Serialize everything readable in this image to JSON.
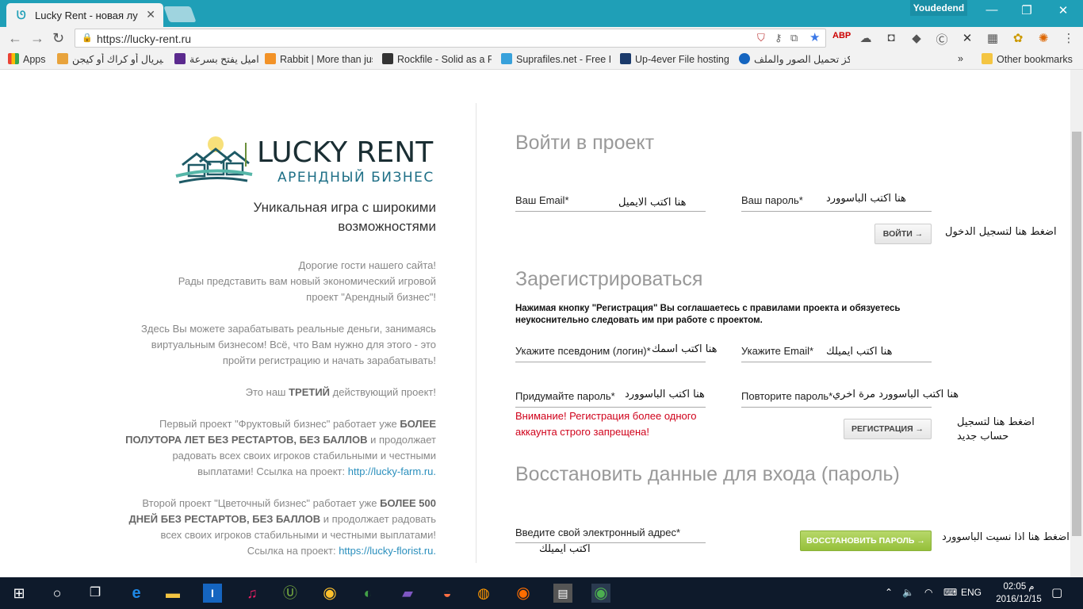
{
  "browser": {
    "tab_title": "Lucky Rent - новая лучш",
    "profile_name": "Youdedend",
    "url": "https://lucky-rent.ru",
    "bookmarks": [
      "Apps",
      "سيريال أو كراك أو كيجن",
      "اميل يفتح بسرعة",
      "Rabbit | More than jus",
      "Rockfile - Solid as a R",
      "Suprafiles.net - Free F",
      "Up-4ever File hosting",
      "مركز تحميل الصور والملف"
    ],
    "bookmarks_overflow": "»",
    "other_bookmarks": "Other bookmarks"
  },
  "brand": {
    "logo_title": "LUCKY RENT",
    "logo_subtitle": "АРЕНДНЫЙ БИЗНЕС",
    "tagline_1": "Уникальная игра с широкими",
    "tagline_2": "возможностями"
  },
  "intro": {
    "p1_l1": "Дорогие гости нашего сайта!",
    "p1_l2": "Рады представить вам новый экономический игровой",
    "p1_l3": "проект \"Арендный бизнес\"!",
    "p2_l1": "Здесь Вы можете зарабатывать реальные деньги, занимаясь",
    "p2_l2": "виртуальным бизнесом! Всё, что Вам нужно для этого - это",
    "p2_l3": "пройти регистрацию и начать зарабатывать!",
    "p3_a": "Это наш ",
    "p3_b": "ТРЕТИЙ",
    "p3_c": " действующий проект!",
    "p4_l1a": "Первый проект \"Фруктовый бизнес\" работает уже ",
    "p4_l1b": "БОЛЕЕ",
    "p4_l2a": "ПОЛУТОРА ЛЕТ БЕЗ РЕСТАРТОВ, БЕЗ БАЛЛОВ",
    "p4_l2b": " и продолжает",
    "p4_l3": "радовать всех своих игроков стабильными и честными",
    "p4_l4a": "выплатами! Ссылка на проект: ",
    "p4_link": "http://lucky-farm.ru.",
    "p5_l1a": "Второй проект \"Цветочный бизнес\" работает уже ",
    "p5_l1b": "БОЛЕЕ 500",
    "p5_l2a": "ДНЕЙ БЕЗ РЕСТАРТОВ, БЕЗ БАЛЛОВ",
    "p5_l2b": " и продолжает радовать",
    "p5_l3": "всех своих игроков стабильными и честными выплатами!",
    "p5_l4a": "Ссылка на проект: ",
    "p5_link": "https://lucky-florist.ru."
  },
  "login": {
    "heading": "Войти в проект",
    "email_label": "Ваш Email*",
    "email_value": "هنا اكتب الايميل",
    "password_label": "Ваш пароль*",
    "password_value": "هنا اكتب الباسوورد",
    "button": "ВОЙТИ →",
    "button_hint": "اضغط هنا لتسجيل الدخول"
  },
  "register": {
    "heading": "Зарегистрироваться",
    "note_1": "Нажимая кнопку \"Регистрация\" Вы соглашаетесь с правилами проекта и обязуетесь",
    "note_2": "неукоснительно следовать им при работе с проектом.",
    "login_label": "Укажите псевдоним (логин)*",
    "login_value": "هنا اكتب اسمك",
    "email_label": "Укажите Email*",
    "email_value": "هنا اكتب ايميلك",
    "password_label": "Придумайте пароль*",
    "password_value": "هنا اكتب الباسوورد",
    "repeat_label": "Повторите пароль*",
    "repeat_value": "هنا اكتب الباسوورد مرة اخري",
    "warning_1": "Внимание! Регистрация более одного",
    "warning_2": "аккаунта строго запрещена!",
    "button": "РЕГИСТРАЦИЯ →",
    "button_hint_1": "اضغط هنا لتسجيل",
    "button_hint_2": "حساب جديد"
  },
  "recover": {
    "heading": "Восстановить данные для входа (пароль)",
    "email_label": "Введите свой электронный адрес*",
    "email_value": "اكتب ايميلك",
    "button": "ВОССТАНОВИТЬ ПАРОЛЬ →",
    "button_hint": "اضغط هنا اذا نسيت الباسوورد"
  },
  "taskbar": {
    "language": "ENG",
    "time": "02:05 م",
    "date": "2016/12/15"
  }
}
